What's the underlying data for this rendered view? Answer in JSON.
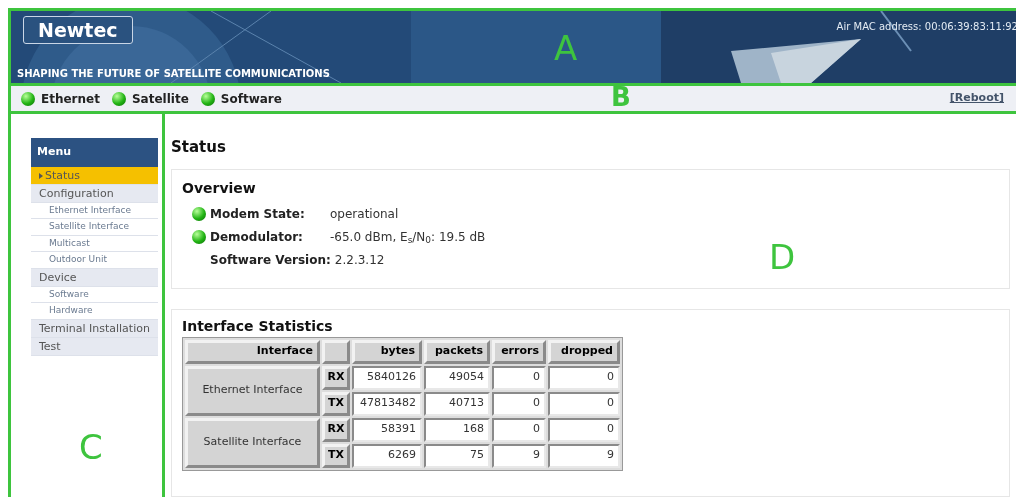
{
  "header": {
    "logo": "Newtec",
    "tagline": "SHAPING THE FUTURE OF SATELLITE COMMUNICATIONS",
    "mac_address": "Air MAC address: 00:06:39:83:11:92"
  },
  "status_bar": {
    "indicators": [
      {
        "label": "Ethernet",
        "on": true
      },
      {
        "label": "Satellite",
        "on": true
      },
      {
        "label": "Software",
        "on": true
      }
    ],
    "reboot_link": "[Reboot]"
  },
  "annotations": [
    "A",
    "B",
    "C",
    "D"
  ],
  "menu": {
    "title": "Menu",
    "items": [
      {
        "label": "Status",
        "selected": true
      },
      {
        "label": "Configuration",
        "selected": false,
        "children": [
          {
            "label": "Ethernet Interface",
            "selected": false
          },
          {
            "label": "Satellite Interface",
            "selected": false
          },
          {
            "label": "Multicast",
            "selected": false
          },
          {
            "label": "Outdoor Unit",
            "selected": false
          }
        ]
      },
      {
        "label": "Device",
        "selected": false,
        "children": [
          {
            "label": "Software",
            "selected": false
          },
          {
            "label": "Hardware",
            "selected": false
          }
        ]
      },
      {
        "label": "Terminal Installation",
        "selected": false
      },
      {
        "label": "Test",
        "selected": false
      }
    ]
  },
  "page_title": "Status",
  "overview": {
    "title": "Overview",
    "rows": [
      {
        "label": "Modem State:",
        "value": "operational",
        "on": true
      },
      {
        "label": "Demodulator:",
        "value": "-65.0 dBm, E$_{s}$/N$_{0}$: 19.5 dB",
        "on": true
      },
      {
        "label": "Software Version:",
        "value": "2.2.3.12"
      }
    ]
  },
  "statistics": {
    "title": "Interface Statistics",
    "columns": [
      "Interface",
      "bytes",
      "packets",
      "errors",
      "dropped"
    ],
    "groups": [
      {
        "interface": "Ethernet Interface",
        "rows": [
          {
            "direction": "RX",
            "values": [
              "5840126",
              "49054",
              "0",
              "0"
            ]
          },
          {
            "direction": "TX",
            "values": [
              "47813482",
              "40713",
              "0",
              "0"
            ]
          }
        ]
      },
      {
        "interface": "Satellite Interface",
        "rows": [
          {
            "direction": "RX",
            "values": [
              "58391",
              "168",
              "0",
              "0"
            ]
          },
          {
            "direction": "TX",
            "values": [
              "6269",
              "75",
              "9",
              "9"
            ]
          }
        ]
      }
    ]
  }
}
